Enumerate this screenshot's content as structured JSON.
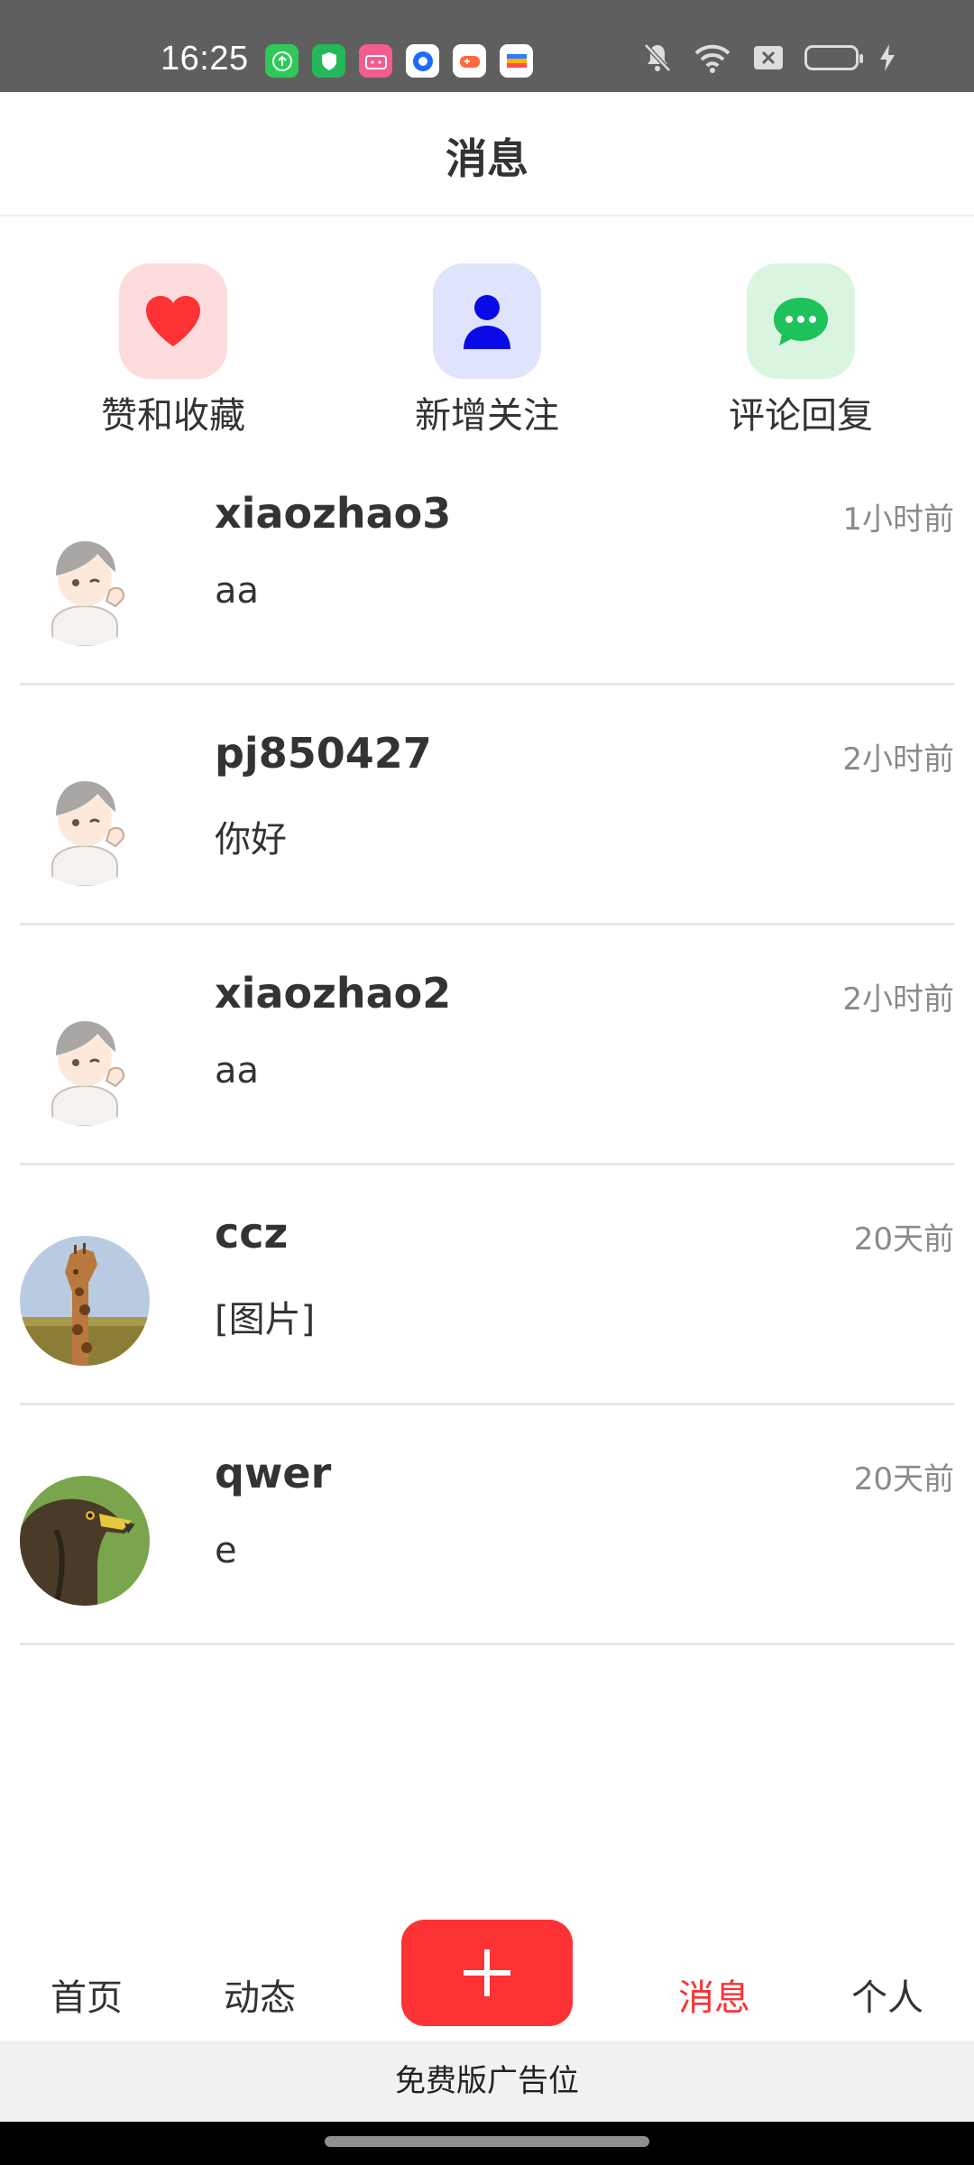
{
  "status_bar": {
    "time": "16:25",
    "app_icons": [
      "upload-icon",
      "shield-icon",
      "bilibili-icon",
      "browser-icon",
      "game-icon",
      "wallet-icon"
    ],
    "system_icons": [
      "mute-icon",
      "wifi-icon",
      "sim-icon",
      "battery-icon",
      "charging-icon"
    ]
  },
  "header": {
    "title": "消息"
  },
  "quick_actions": [
    {
      "label": "赞和收藏",
      "icon": "heart-icon",
      "tile_color": "#fcdcdc",
      "icon_color": "#fc3234"
    },
    {
      "label": "新增关注",
      "icon": "user-icon",
      "tile_color": "#dfe3fb",
      "icon_color": "#0a0ae8"
    },
    {
      "label": "评论回复",
      "icon": "chat-icon",
      "tile_color": "#d9f5e0",
      "icon_color": "#1ec25a"
    }
  ],
  "messages": [
    {
      "name": "xiaozhao3",
      "time": "1小时前",
      "preview": "aa",
      "avatar": "cartoon-avatar"
    },
    {
      "name": "pj850427",
      "time": "2小时前",
      "preview": "你好",
      "avatar": "cartoon-avatar"
    },
    {
      "name": "xiaozhao2",
      "time": "2小时前",
      "preview": "aa",
      "avatar": "cartoon-avatar"
    },
    {
      "name": "ccz",
      "time": "20天前",
      "preview": "[图片]",
      "avatar": "giraffe-photo"
    },
    {
      "name": "qwer",
      "time": "20天前",
      "preview": "e",
      "avatar": "eagle-photo"
    }
  ],
  "bottom_nav": {
    "items": [
      {
        "label": "首页",
        "active": false
      },
      {
        "label": "动态",
        "active": false
      },
      {
        "label": "消息",
        "active": true
      },
      {
        "label": "个人",
        "active": false
      }
    ],
    "active_color": "#fc3234",
    "publish_icon": "plus-icon"
  },
  "ad": {
    "label": "免费版广告位"
  }
}
